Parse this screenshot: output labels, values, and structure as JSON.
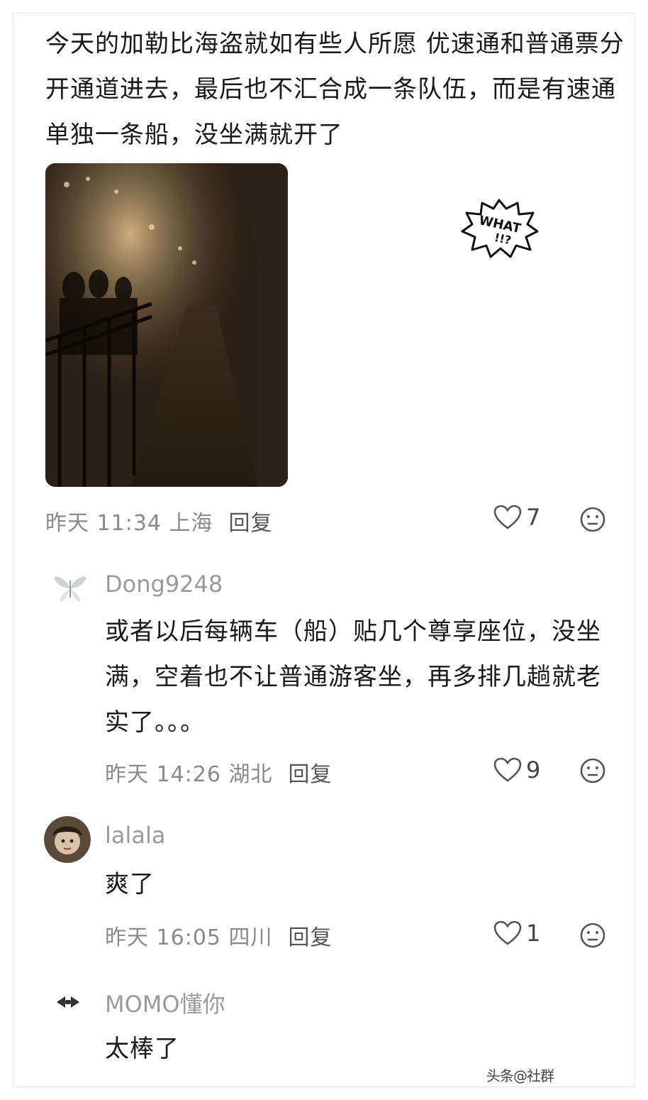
{
  "post": {
    "text": "今天的加勒比海盗就如有些人所愿 优速通和普通票分开通道进去，最后也不汇合成一条队伍，而是有速通单独一条船，没坐满就开了",
    "sticker_text_1": "WHAT",
    "sticker_text_2": "!!?",
    "time": "昨天 11:34",
    "location": "上海",
    "reply_label": "回复",
    "likes": "7"
  },
  "comments": [
    {
      "username": "Dong9248",
      "text": "或者以后每辆车（船）贴几个尊享座位，没坐满，空着也不让普通游客坐，再多排几趟就老实了。。。",
      "time": "昨天 14:26",
      "location": "湖北",
      "reply_label": "回复",
      "likes": "9"
    },
    {
      "username": "lalala",
      "text": "爽了",
      "time": "昨天 16:05",
      "location": "四川",
      "reply_label": "回复",
      "likes": "1"
    },
    {
      "username": "MOMO懂你",
      "text": "太棒了"
    }
  ],
  "watermark": "头条@社群",
  "colors": {
    "meta": "#8a8a8a",
    "text": "#1a1a1a",
    "username": "#9a9a9a"
  }
}
